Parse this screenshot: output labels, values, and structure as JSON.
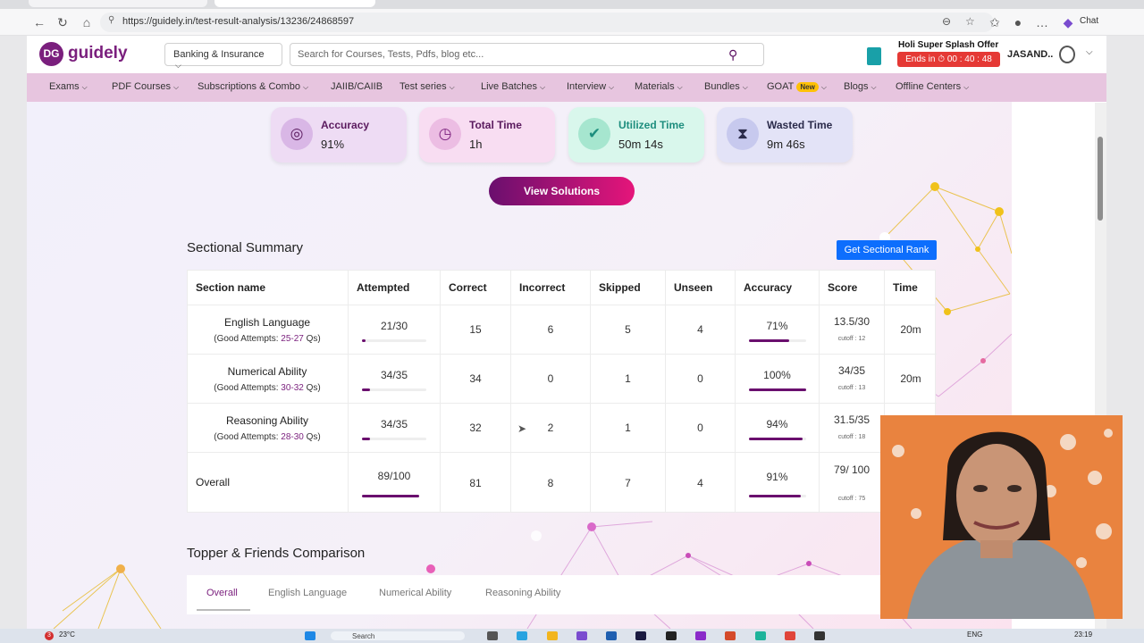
{
  "browser": {
    "url": "https://guidely.in/test-result-analysis/13236/24868597",
    "chat_label": "Chat"
  },
  "header": {
    "logo_badge": "DG",
    "logo_text": "guidely",
    "category": "Banking & Insurance",
    "search_placeholder": "Search for Courses, Tests, Pdfs, blog etc...",
    "offer_title": "Holi Super Splash Offer",
    "offer_timer": "Ends in ⏱ 00 : 40 : 48",
    "user_name": "JASAND..",
    "icons": [
      "search-icon",
      "gift-icon",
      "user-icon",
      "chevron-down-icon"
    ]
  },
  "menu": {
    "items": [
      "Exams",
      "PDF Courses",
      "Subscriptions & Combo",
      "JAIIB/CAIIB",
      "Test series",
      "Live Batches",
      "Interview",
      "Materials",
      "Bundles",
      "GOAT",
      "Blogs",
      "Offline Centers"
    ],
    "new_badge": "New"
  },
  "stats": [
    {
      "label": "Accuracy",
      "value": "91%",
      "icon": "target-icon",
      "label_color": "#5a1a5e"
    },
    {
      "label": "Total Time",
      "value": "1h",
      "icon": "clock-icon",
      "label_color": "#5a1a5e"
    },
    {
      "label": "Utilized Time",
      "value": "50m 14s",
      "icon": "check-shield-icon",
      "label_color": "#1e8e7e"
    },
    {
      "label": "Wasted Time",
      "value": "9m 46s",
      "icon": "hourglass-down-icon",
      "label_color": "#2a2a4a"
    }
  ],
  "view_solutions": "View Solutions",
  "sectional_summary": {
    "title": "Sectional Summary",
    "rank_button": "Get Sectional Rank",
    "headers": [
      "Section name",
      "Attempted",
      "Correct",
      "Incorrect",
      "Skipped",
      "Unseen",
      "Accuracy",
      "Score",
      "Time"
    ],
    "rows": [
      {
        "name": "English Language",
        "good_prefix": "(Good Attempts: ",
        "good_range": "25-27",
        "good_suffix": " Qs)",
        "attempted": "21/30",
        "attempted_fraction": 0.05,
        "correct": "15",
        "incorrect": "6",
        "skipped": "5",
        "unseen": "4",
        "accuracy": "71%",
        "accuracy_fraction": 0.71,
        "score": "13.5/30",
        "cutoff": "cutoff : 12",
        "time": "20m"
      },
      {
        "name": "Numerical Ability",
        "good_prefix": "(Good Attempts: ",
        "good_range": "30-32",
        "good_suffix": " Qs)",
        "attempted": "34/35",
        "attempted_fraction": 0.12,
        "correct": "34",
        "incorrect": "0",
        "skipped": "1",
        "unseen": "0",
        "accuracy": "100%",
        "accuracy_fraction": 1.0,
        "score": "34/35",
        "cutoff": "cutoff : 13",
        "time": "20m"
      },
      {
        "name": "Reasoning Ability",
        "good_prefix": "(Good Attempts: ",
        "good_range": "28-30",
        "good_suffix": " Qs)",
        "attempted": "34/35",
        "attempted_fraction": 0.12,
        "correct": "32",
        "incorrect": "2",
        "skipped": "1",
        "unseen": "0",
        "accuracy": "94%",
        "accuracy_fraction": 0.94,
        "score": "31.5/35",
        "cutoff": "cutoff : 18",
        "time": ""
      }
    ],
    "overall": {
      "name": "Overall",
      "attempted": "89/100",
      "attempted_fraction": 1.0,
      "correct": "81",
      "incorrect": "8",
      "skipped": "7",
      "unseen": "4",
      "accuracy": "91%",
      "accuracy_fraction": 0.91,
      "score": "79/ 100",
      "cutoff": "cutoff : 75"
    }
  },
  "topper": {
    "title": "Topper & Friends Comparison",
    "tabs": [
      "Overall",
      "English Language",
      "Numerical Ability",
      "Reasoning Ability"
    ]
  },
  "taskbar": {
    "weather": "23°C",
    "search": "Search",
    "lang": "ENG",
    "time": "23:19",
    "notif_count": "3"
  },
  "colors": {
    "brand": "#7a1f7d",
    "menu_bg": "#e7c5df",
    "rank_btn": "#0d6efd",
    "timer_bg": "#e53935"
  }
}
